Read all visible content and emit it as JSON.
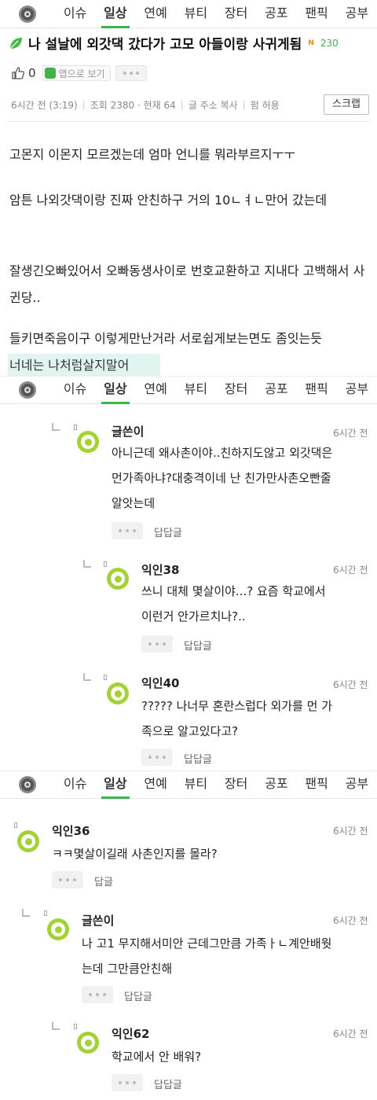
{
  "tabs": [
    "이슈",
    "일상",
    "연예",
    "뷰티",
    "장터",
    "공포",
    "팬픽",
    "공부"
  ],
  "active_tab": "일상",
  "post": {
    "title": "나 설날에 외갓댁 갔다가 고모 아들이랑 사귀게됨",
    "new_badge": "N",
    "comment_count": "230",
    "like_count": "0",
    "app_button": "앱으로 보기",
    "time": "6시간 전 (3:19)",
    "views": "조회 2380 · 현재 64",
    "copy_url": "글 주소 복사",
    "repost": "펌 허용",
    "scrap": "스크랩",
    "body": [
      "고몬지 이몬지 모르겠는데 엄마 언니를 뭐라부르지ㅜㅜ",
      "암튼 나외갓댁이랑 진짜 안친하구 거의 10ㄴㅕㄴ만어 갔는데",
      "잘생긴오빠있어서 오빠동생사이로 번호교환하고 지내다 고백해서 사귄당..",
      "들키면죽음이구 이렇게만난거라 서로쉽게보는면도 좀잇는듯"
    ],
    "highlight": "너네는 나처럼살지말어"
  },
  "comments_a": [
    {
      "name": "글쓴이",
      "time": "6시간 전",
      "lines": [
        "아니근데 왜사촌이야..친하지도않고 외갓댁은",
        "먼가족아냐?대충격이네 난 친가만사촌오빤줄",
        "알앗는데"
      ],
      "reply_label": "답답글"
    },
    {
      "name": "익인38",
      "time": "6시간 전",
      "lines": [
        "쓰니 대체 몇살이야...? 요즘 학교에서",
        "이런거 안가르치나?.."
      ],
      "reply_label": "답답글"
    },
    {
      "name": "익인40",
      "time": "6시간 전",
      "lines": [
        "????? 나너무 혼란스럽다 외가를 먼 가",
        "족으로 알고있다고?"
      ],
      "reply_label": "답답글"
    }
  ],
  "comments_b": [
    {
      "name": "익인36",
      "time": "6시간 전",
      "lines": [
        "ㅋㅋ몇살이길래 사촌인지를 몰라?"
      ],
      "reply_label": "답글"
    },
    {
      "name": "글쓴이",
      "time": "6시간 전",
      "lines": [
        "나 고1 무지해서미안 근데그만큼 가족ㅏㄴ계안배웟",
        "는데 그만큼안친해"
      ],
      "reply_label": "답답글"
    },
    {
      "name": "익인62",
      "time": "6시간 전",
      "lines": [
        "학교에서 안 배워?"
      ],
      "reply_label": "답답글"
    }
  ]
}
